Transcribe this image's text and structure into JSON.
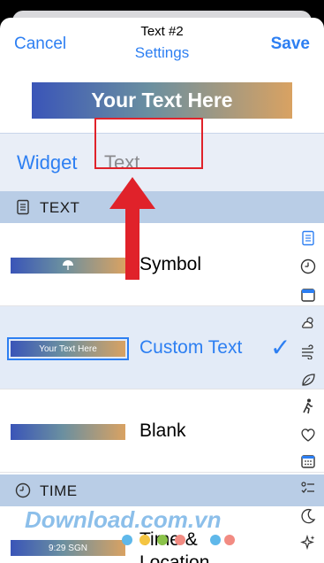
{
  "nav": {
    "cancel_label": "Cancel",
    "title": "Text #2",
    "subtitle": "Settings",
    "save_label": "Save"
  },
  "preview": {
    "text": "Your Text Here"
  },
  "widget_field": {
    "label": "Widget",
    "value": "Text"
  },
  "sections": [
    {
      "label": "TEXT",
      "icon": "document-icon"
    },
    {
      "label": "TIME",
      "icon": "clock-icon"
    }
  ],
  "rows": [
    {
      "label": "Symbol",
      "preview": "",
      "selected": false
    },
    {
      "label": "Custom Text",
      "preview": "Your Text Here",
      "selected": true
    },
    {
      "label": "Blank",
      "preview": "",
      "selected": false
    },
    {
      "label": "Time &",
      "label2": "Location",
      "preview": "9:29 SGN",
      "selected": false
    }
  ],
  "checkmark": "✓",
  "index_icons": [
    "document-icon",
    "clock-icon",
    "calendar-icon",
    "weather-icon",
    "wind-icon",
    "leaf-icon",
    "walking-icon",
    "heart-icon",
    "calendar-grid-icon",
    "checklist-icon",
    "moon-icon",
    "sparkle-icon"
  ],
  "watermark": {
    "text": "Download.com.vn"
  },
  "colors": {
    "accent": "#2d7ff2",
    "header": "#b9cde6",
    "selected_row": "#e3ebf7",
    "annotation_red": "#e0222a"
  }
}
